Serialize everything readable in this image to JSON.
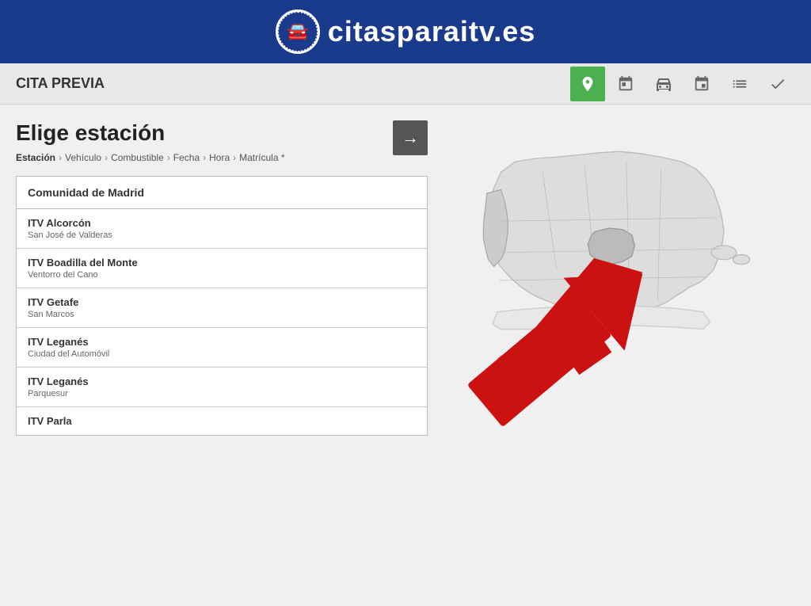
{
  "header": {
    "site_name": "citasparaitv.es",
    "logo_icon": "car-icon"
  },
  "navbar": {
    "title": "CITA PREVIA",
    "icons": [
      {
        "name": "location-icon",
        "symbol": "📍",
        "active": true
      },
      {
        "name": "calendar-grid-icon",
        "symbol": "▦",
        "active": false
      },
      {
        "name": "car-icon",
        "symbol": "🚗",
        "active": false
      },
      {
        "name": "calendar-icon",
        "symbol": "📅",
        "active": false
      },
      {
        "name": "list-icon",
        "symbol": "☰",
        "active": false
      },
      {
        "name": "check-icon",
        "symbol": "✔",
        "active": false
      }
    ]
  },
  "page": {
    "heading": "Elige estación",
    "breadcrumb": [
      {
        "label": "Estación",
        "active": true
      },
      {
        "label": "Vehículo"
      },
      {
        "label": "Combustible"
      },
      {
        "label": "Fecha"
      },
      {
        "label": "Hora"
      },
      {
        "label": "Matrícula *"
      }
    ]
  },
  "next_button": "→",
  "station_group": {
    "region": "Comunidad de Madrid",
    "stations": [
      {
        "name": "ITV Alcorcón",
        "address": "San José de Valderas"
      },
      {
        "name": "ITV Boadilla del Monte",
        "address": "Ventorro del Cano"
      },
      {
        "name": "ITV Getafe",
        "address": "San Marcos"
      },
      {
        "name": "ITV Leganés",
        "address": "Ciudad del Automóvil"
      },
      {
        "name": "ITV Leganés",
        "address": "Parquesur"
      },
      {
        "name": "ITV Parla",
        "address": ""
      }
    ]
  }
}
